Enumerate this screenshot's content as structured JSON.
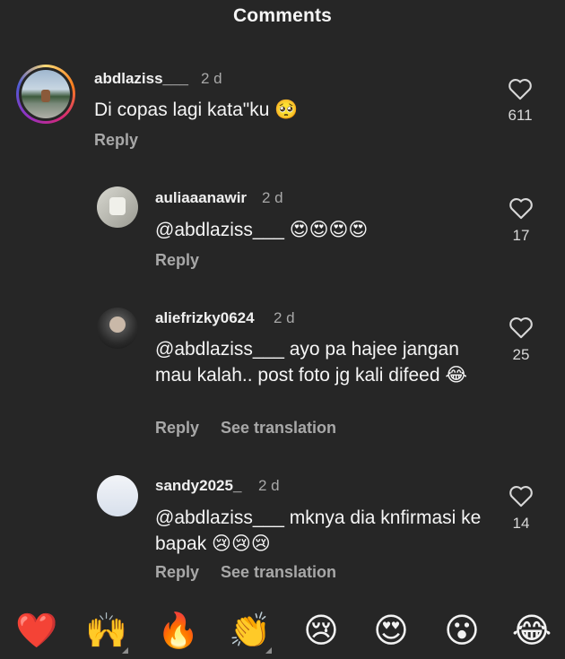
{
  "header": {
    "title": "Comments"
  },
  "comments": [
    {
      "username": "abdlaziss___",
      "time": "2 d",
      "text": "Di copas lagi kata\"ku 🥺",
      "likes": "611",
      "reply_label": "Reply"
    },
    {
      "username": "auliaaanawir",
      "time": "2 d",
      "text": "@abdlaziss___ 😍😍😍😍",
      "likes": "17",
      "reply_label": "Reply"
    },
    {
      "username": "aliefrizky0624",
      "time": "2 d",
      "text": "@abdlaziss___ ayo pa hajee jangan mau kalah.. post foto jg kali difeed 😂",
      "likes": "25",
      "reply_label": "Reply",
      "translation_label": "See translation"
    },
    {
      "username": "sandy2025_",
      "time": "2 d",
      "text": "@abdlaziss___ mknya dia knfirmasi ke bapak 😢😢😢",
      "likes": "14",
      "reply_label": "Reply",
      "translation_label": "See translation"
    }
  ],
  "reactions": [
    {
      "emoji": "❤️",
      "icon": "heart-emoji-icon"
    },
    {
      "emoji": "🙌",
      "icon": "raising-hands-emoji-icon"
    },
    {
      "emoji": "🔥",
      "icon": "fire-emoji-icon"
    },
    {
      "emoji": "👏",
      "icon": "clapping-hands-emoji-icon"
    },
    {
      "emoji": "😢",
      "icon": "crying-face-emoji-icon"
    },
    {
      "emoji": "😍",
      "icon": "heart-eyes-emoji-icon"
    },
    {
      "emoji": "😮",
      "icon": "surprised-face-emoji-icon"
    },
    {
      "emoji": "😂",
      "icon": "tears-of-joy-emoji-icon"
    }
  ],
  "colors": {
    "background": "#262626",
    "text": "#f5f5f5",
    "secondary": "#a8a8a8"
  }
}
